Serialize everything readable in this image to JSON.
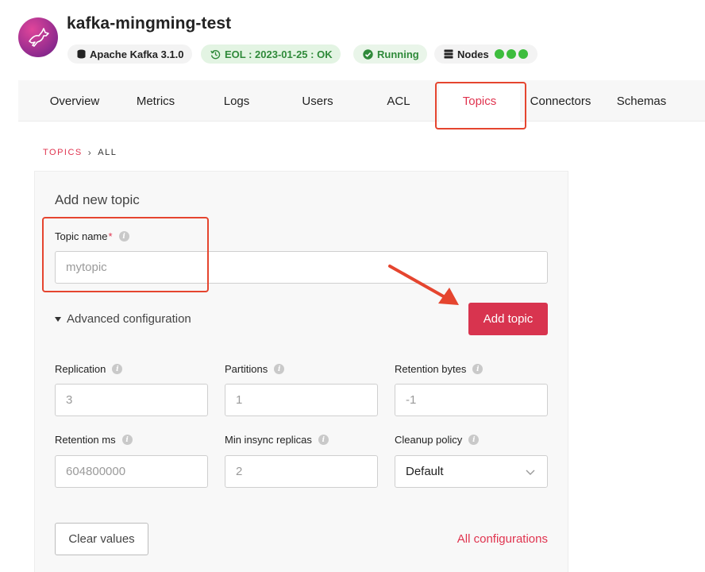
{
  "header": {
    "title": "kafka-mingming-test",
    "logo_icon": "kafka-logo-icon",
    "badges": {
      "version": "Apache Kafka 3.1.0",
      "eol": "EOL : 2023-01-25 : OK",
      "status": "Running",
      "nodes": "Nodes",
      "node_count": 3
    }
  },
  "tabs": [
    {
      "label": "Overview"
    },
    {
      "label": "Metrics"
    },
    {
      "label": "Logs"
    },
    {
      "label": "Users"
    },
    {
      "label": "ACL"
    },
    {
      "label": "Topics",
      "active": true
    },
    {
      "label": "Connectors"
    },
    {
      "label": "Schemas"
    }
  ],
  "breadcrumb": {
    "root": "TOPICS",
    "current": "ALL"
  },
  "form": {
    "title": "Add new topic",
    "topic_name": {
      "label": "Topic name",
      "required_mark": "*",
      "placeholder": "mytopic"
    },
    "advanced_label": "Advanced configuration",
    "add_button": "Add topic",
    "replication": {
      "label": "Replication",
      "placeholder": "3"
    },
    "partitions": {
      "label": "Partitions",
      "placeholder": "1"
    },
    "retention_bytes": {
      "label": "Retention bytes",
      "placeholder": "-1"
    },
    "retention_ms": {
      "label": "Retention ms",
      "placeholder": "604800000"
    },
    "min_insync": {
      "label": "Min insync replicas",
      "placeholder": "2"
    },
    "cleanup_policy": {
      "label": "Cleanup policy",
      "value": "Default"
    },
    "clear_button": "Clear values",
    "all_configs_link": "All configurations"
  },
  "colors": {
    "accent": "#d8344f",
    "highlight": "#e5452f",
    "success": "#2f8a3a",
    "node_dot": "#3dbd3d"
  }
}
